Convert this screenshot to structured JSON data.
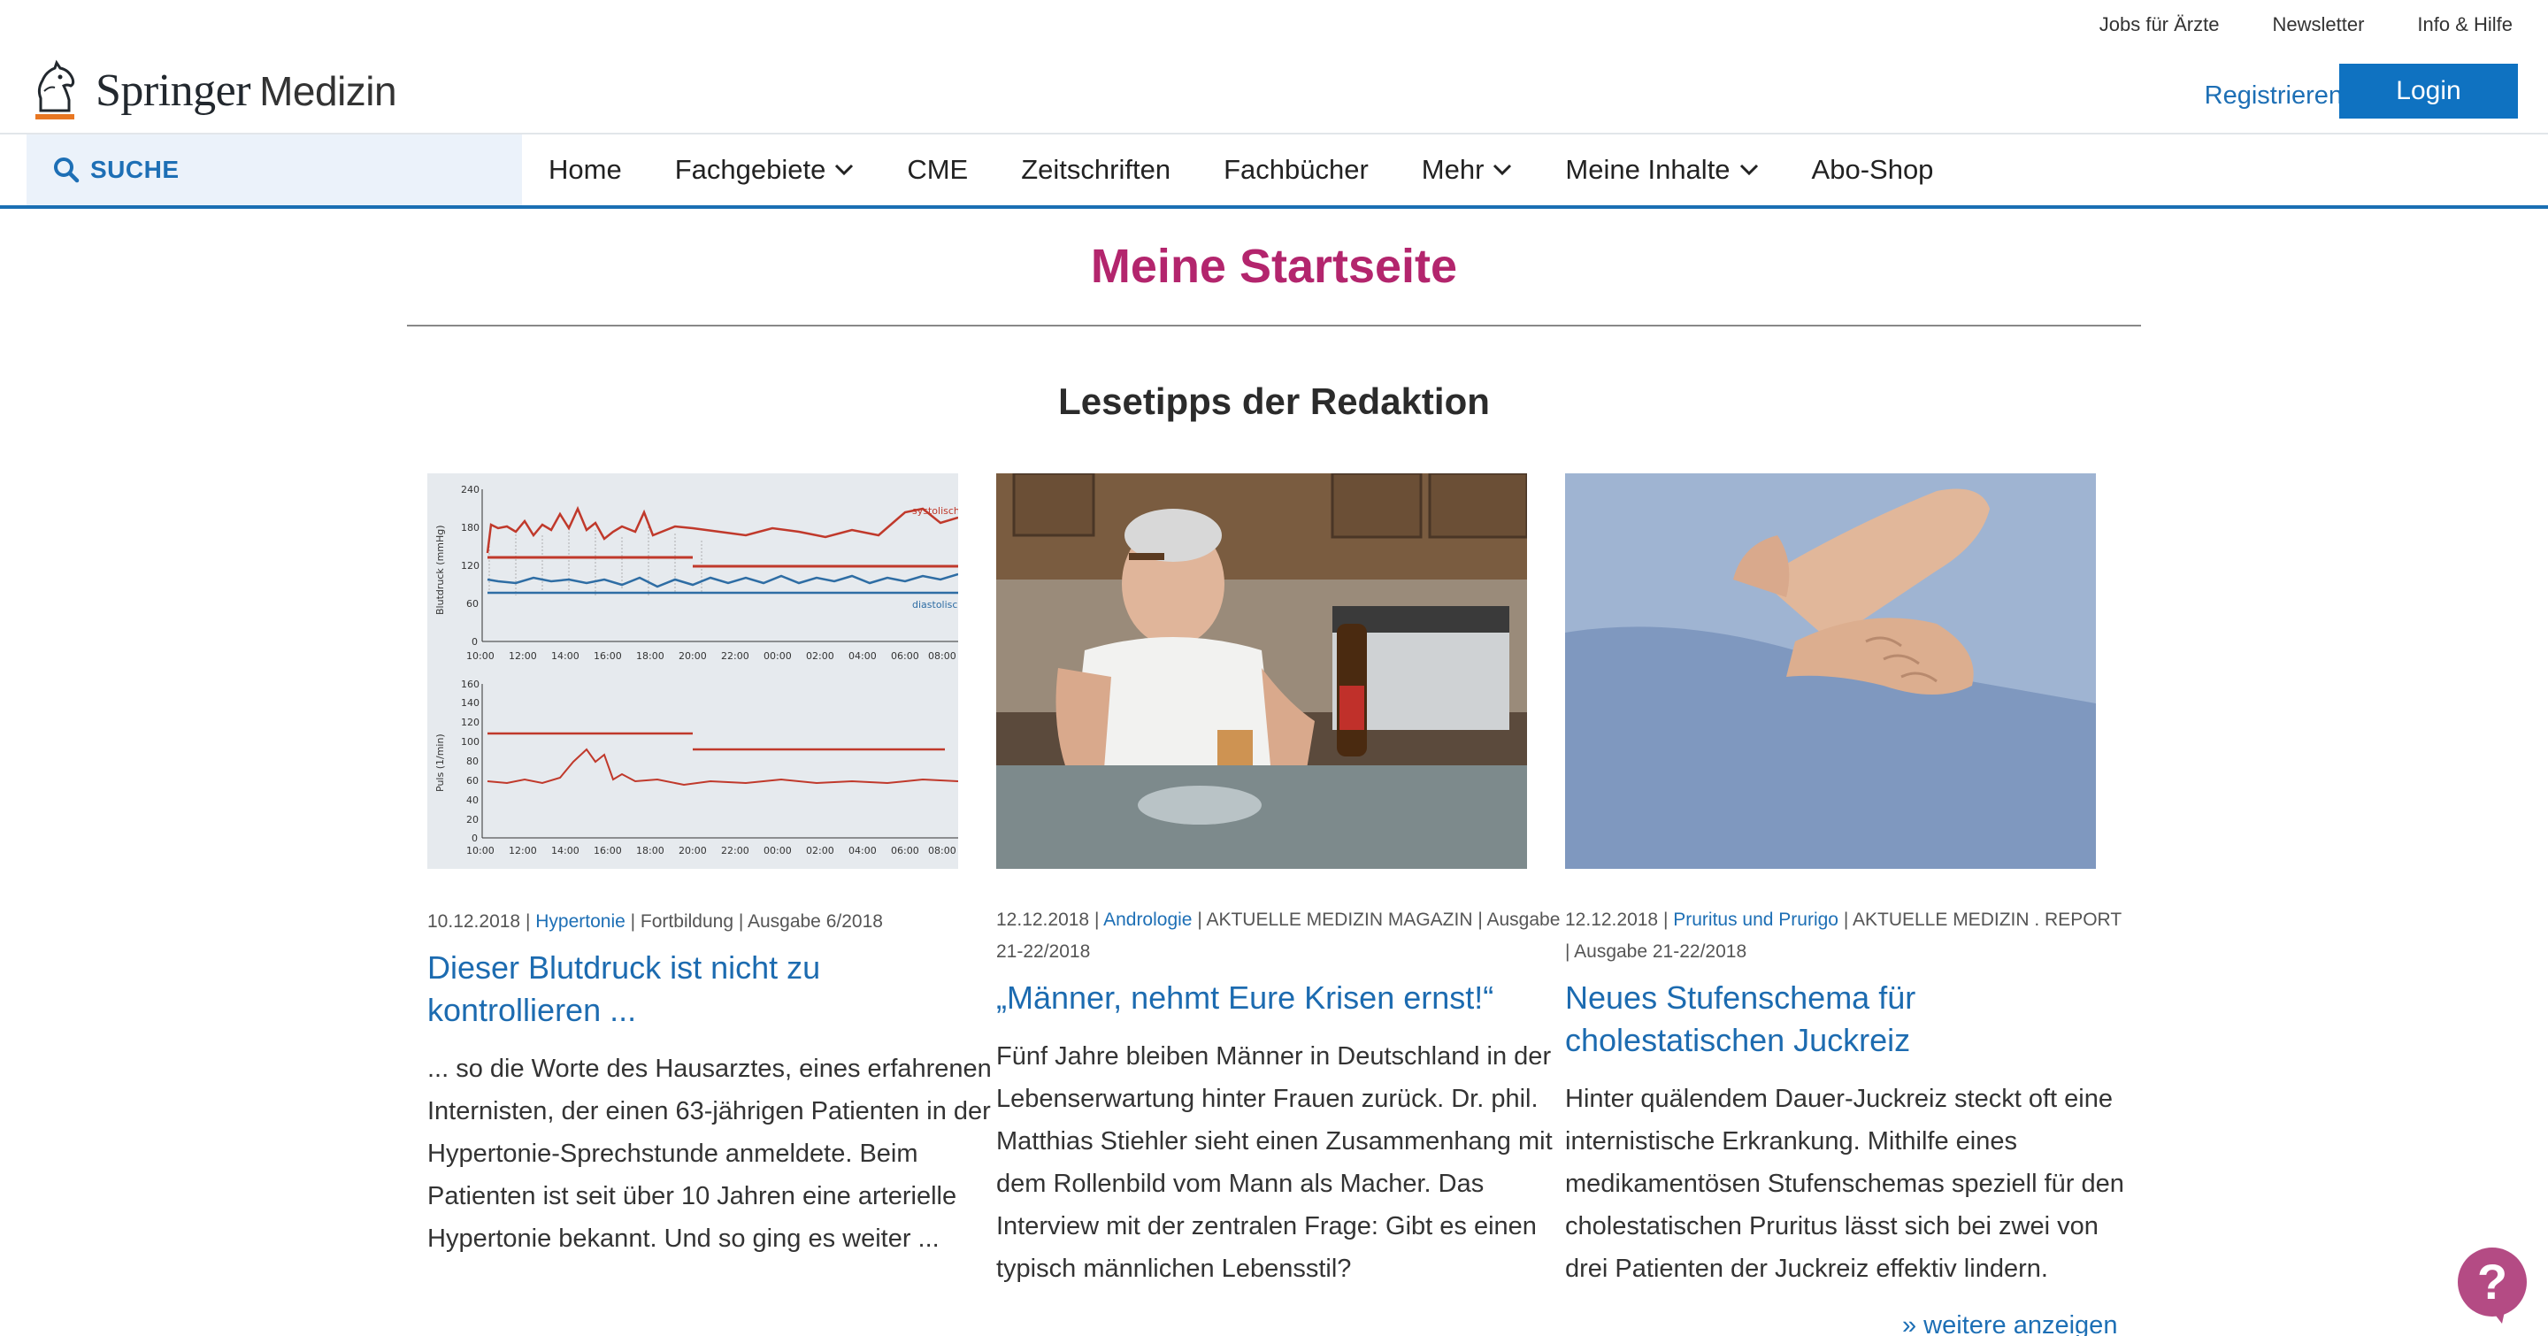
{
  "utility_nav": [
    "Jobs für Ärzte",
    "Newsletter",
    "Info & Hilfe"
  ],
  "header": {
    "logo_brand": "Springer",
    "logo_sub": "Medizin",
    "register_label": "Registrieren",
    "login_label": "Login"
  },
  "nav": {
    "search_label": "SUCHE",
    "items": [
      {
        "label": "Home",
        "dropdown": false
      },
      {
        "label": "Fachgebiete",
        "dropdown": true
      },
      {
        "label": "CME",
        "dropdown": false
      },
      {
        "label": "Zeitschriften",
        "dropdown": false
      },
      {
        "label": "Fachbücher",
        "dropdown": false
      },
      {
        "label": "Mehr",
        "dropdown": true
      },
      {
        "label": "Meine Inhalte",
        "dropdown": true
      },
      {
        "label": "Abo-Shop",
        "dropdown": false
      }
    ]
  },
  "page_title": "Meine Startseite",
  "section_title": "Lesetipps der Redaktion",
  "articles": [
    {
      "date": "10.12.2018",
      "category": "Hypertonie",
      "meta_rest": "| Fortbildung | Ausgabe 6/2018",
      "headline": "Dieser Blutdruck ist nicht zu kontrollieren ...",
      "teaser": "... so die Worte des Hausarztes, eines erfahrenen Internisten, der einen 63-jährigen Patienten in der Hypertonie-Sprechstunde anmeldete. Beim Patienten ist seit über 10 Jahren eine arterielle Hypertonie bekannt. Und so ging es weiter ...",
      "chart_labels": {
        "top_ylabel": "Blutdruck (mmHg)",
        "bottom_ylabel": "Puls (1/min)",
        "top_yticks": [
          "240",
          "180",
          "120",
          "60",
          "0"
        ],
        "bottom_yticks": [
          "160",
          "140",
          "120",
          "100",
          "80",
          "60",
          "40",
          "20",
          "0"
        ],
        "xticks": [
          "10:00",
          "12:00",
          "14:00",
          "16:00",
          "18:00",
          "20:00",
          "22:00",
          "00:00",
          "02:00",
          "04:00",
          "06:00",
          "08:00"
        ],
        "series_top": "systolisch",
        "series_bottom": "diastolisch"
      }
    },
    {
      "date": "12.12.2018",
      "category": "Andrologie",
      "meta_rest": "| AKTUELLE MEDIZIN MAGAZIN | Ausgabe 21-22/2018",
      "headline": "„Männer, nehmt Eure Krisen ernst!“",
      "teaser": "Fünf Jahre bleiben Männer in Deutschland in der Lebenserwartung hinter Frauen zurück. Dr. phil. Matthias Stiehler sieht einen Zusammenhang mit dem Rollenbild vom Mann als Macher. Das Interview mit der zentralen Frage: Gibt es einen typisch männlichen Lebensstil?"
    },
    {
      "date": "12.12.2018",
      "category": "Pruritus und Prurigo",
      "meta_rest": "| AKTUELLE MEDIZIN . REPORT | Ausgabe 21-22/2018",
      "headline": "Neues Stufenschema für cholestatischen Juckreiz",
      "teaser": "Hinter quälendem Dauer-Juckreiz steckt oft eine internistische Erkrankung. Mithilfe eines medikamentösen Stufenschemas speziell für den cholestatischen Pruritus lässt sich bei zwei von drei Patienten der Juckreiz effektiv lindern."
    }
  ],
  "more_link": "» weitere anzeigen",
  "help_label": "?",
  "colors": {
    "accent_blue": "#1d6fb5",
    "title_magenta": "#b3256d",
    "help_bubble": "#b44b84"
  }
}
